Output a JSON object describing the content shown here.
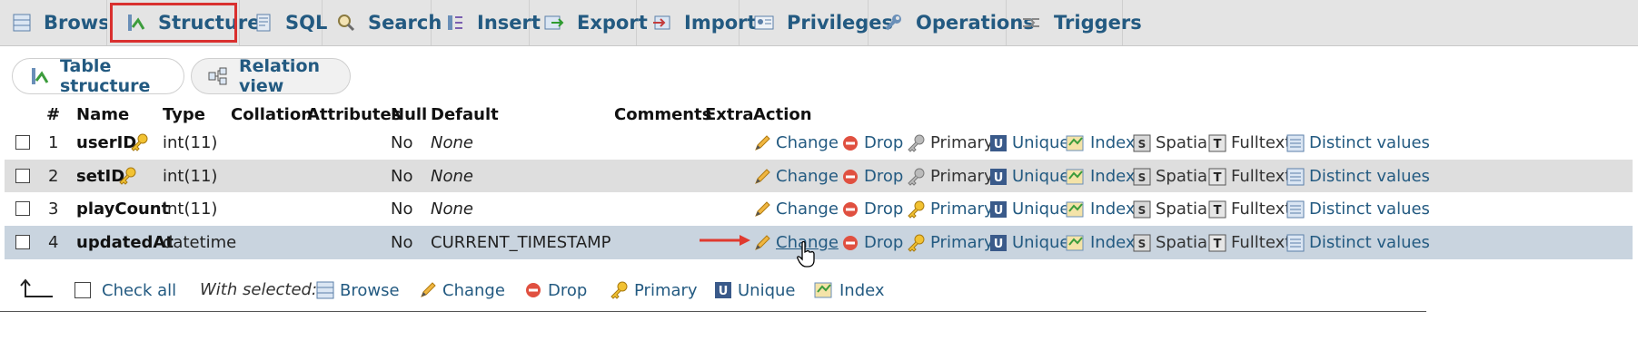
{
  "tabs": [
    {
      "label": "Browse",
      "icon": "browse-icon"
    },
    {
      "label": "Structure",
      "icon": "structure-icon",
      "active": true
    },
    {
      "label": "SQL",
      "icon": "sql-icon"
    },
    {
      "label": "Search",
      "icon": "search-icon"
    },
    {
      "label": "Insert",
      "icon": "insert-icon"
    },
    {
      "label": "Export",
      "icon": "export-icon"
    },
    {
      "label": "Import",
      "icon": "import-icon"
    },
    {
      "label": "Privileges",
      "icon": "privileges-icon"
    },
    {
      "label": "Operations",
      "icon": "wrench-icon"
    },
    {
      "label": "Triggers",
      "icon": "triggers-icon"
    }
  ],
  "subtabs": {
    "table_structure": "Table structure",
    "relation_view": "Relation view"
  },
  "columns": [
    "#",
    "Name",
    "Type",
    "Collation",
    "Attributes",
    "Null",
    "Default",
    "Comments",
    "Extra",
    "Action"
  ],
  "rows": [
    {
      "num": "1",
      "name": "userID",
      "key": true,
      "type": "int(11)",
      "collation": "",
      "attributes": "",
      "null": "No",
      "default": "None",
      "default_italic": true,
      "extra": "",
      "primary_enabled": false
    },
    {
      "num": "2",
      "name": "setID",
      "key": true,
      "type": "int(11)",
      "collation": "",
      "attributes": "",
      "null": "No",
      "default": "None",
      "default_italic": true,
      "extra": "",
      "primary_enabled": false
    },
    {
      "num": "3",
      "name": "playCount",
      "key": false,
      "type": "int(11)",
      "collation": "",
      "attributes": "",
      "null": "No",
      "default": "None",
      "default_italic": true,
      "extra": "",
      "primary_enabled": true
    },
    {
      "num": "4",
      "name": "updatedAt",
      "key": false,
      "type": "datetime",
      "collation": "",
      "attributes": "",
      "null": "No",
      "default": "CURRENT_TIMESTAMP",
      "default_italic": false,
      "extra": "",
      "primary_enabled": true,
      "hovered": true
    }
  ],
  "actions": {
    "change": "Change",
    "drop": "Drop",
    "primary": "Primary",
    "unique": "Unique",
    "index": "Index",
    "spatial": "Spatial",
    "fulltext": "Fulltext",
    "distinct": "Distinct values"
  },
  "bottom": {
    "check_all": "Check all",
    "with_selected": "With selected:",
    "browse": "Browse",
    "change": "Change",
    "drop": "Drop",
    "primary": "Primary",
    "unique": "Unique",
    "index": "Index"
  },
  "colors": {
    "link": "#235a81",
    "active_outline": "#d9302f",
    "hover_row": "#c9d4df",
    "alt_row": "#dedede",
    "arrow": "#e03a2f"
  }
}
